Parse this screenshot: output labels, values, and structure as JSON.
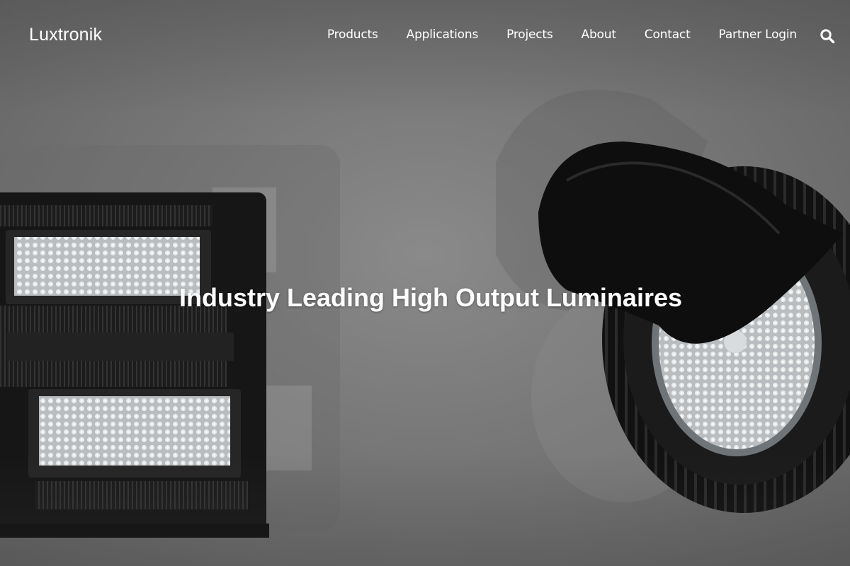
{
  "brand": {
    "name": "Luxtronik"
  },
  "nav": {
    "items": [
      {
        "label": "Products"
      },
      {
        "label": "Applications"
      },
      {
        "label": "Projects"
      },
      {
        "label": "About"
      },
      {
        "label": "Contact"
      },
      {
        "label": "Partner Login"
      }
    ],
    "search_icon": "search-icon"
  },
  "hero": {
    "headline": "Industry Leading High Output Luminaires",
    "images": [
      "flood-light-fixture",
      "high-bay-light-fixture"
    ]
  },
  "colors": {
    "background": "#7a7a7a",
    "text": "#ffffff",
    "fixture": "#1a1a1a"
  }
}
